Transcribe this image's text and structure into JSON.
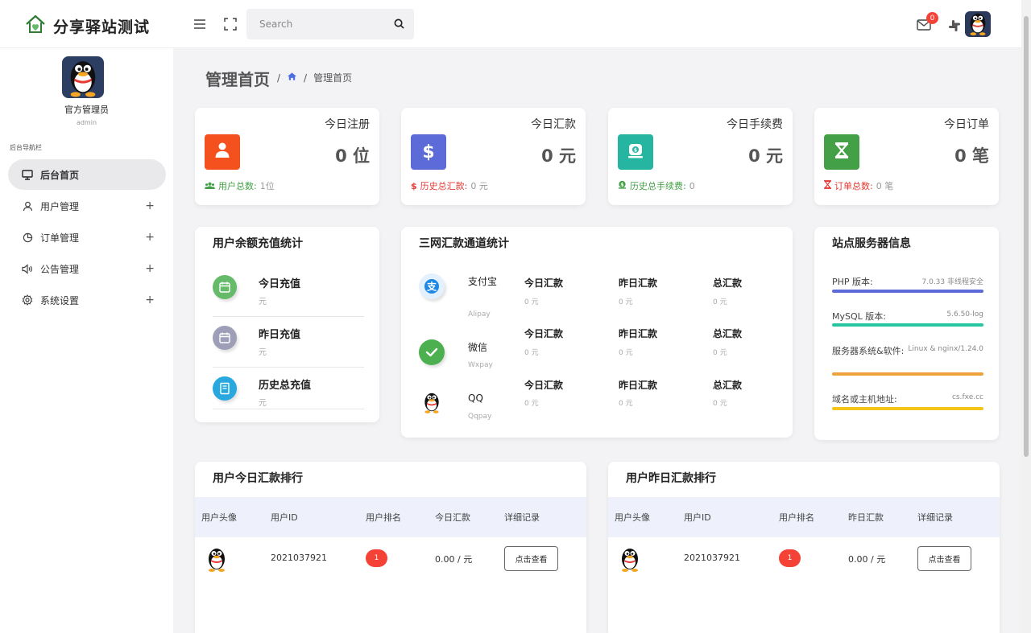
{
  "brand": {
    "name": "分享驿站测试"
  },
  "header": {
    "search_placeholder": "Search",
    "mail_badge": "0"
  },
  "sidebar": {
    "user_name": "官方管理员",
    "user_role": "admin",
    "section_title": "后台导航栏",
    "items": [
      {
        "label": "后台首页",
        "icon": "monitor-icon",
        "active": true
      },
      {
        "label": "用户管理",
        "icon": "user-icon",
        "expand": "+"
      },
      {
        "label": "订单管理",
        "icon": "pie-chart-icon",
        "expand": "+"
      },
      {
        "label": "公告管理",
        "icon": "speaker-icon",
        "expand": "+"
      },
      {
        "label": "系统设置",
        "icon": "gear-icon",
        "expand": "+"
      }
    ]
  },
  "page": {
    "title": "管理首页",
    "breadcrumb_sep": "/",
    "breadcrumb_current": "管理首页"
  },
  "stats": [
    {
      "title": "今日注册",
      "value": "0 位",
      "icon_color": "#f4511e",
      "foot_label": "用户总数:",
      "foot_value": "1位",
      "foot_color": "#43a047",
      "icon": "user-icon"
    },
    {
      "title": "今日汇款",
      "value": "0 元",
      "icon_color": "#5c6bd8",
      "foot_label": "历史总汇款:",
      "foot_value": "0 元",
      "foot_color": "#e53935",
      "icon": "dollar-icon"
    },
    {
      "title": "今日手续费",
      "value": "0 元",
      "icon_color": "#26b5a0",
      "foot_label": "历史总手续费:",
      "foot_value": "0",
      "foot_color": "#43a047",
      "icon": "money-bag-icon"
    },
    {
      "title": "今日订单",
      "value": "0 笔",
      "icon_color": "#43a047",
      "foot_label": "订单总数:",
      "foot_value": "0 笔",
      "foot_color": "#e53935",
      "icon": "hourglass-icon"
    }
  ],
  "recharge": {
    "title": "用户余额充值统计",
    "rows": [
      {
        "label": "今日充值",
        "value": "元",
        "color": "#66bb6a",
        "icon": "calendar-icon"
      },
      {
        "label": "昨日充值",
        "value": "元",
        "color": "#9e9eb8",
        "icon": "calendar-icon"
      },
      {
        "label": "历史总充值",
        "value": "元",
        "color": "#29a8e0",
        "icon": "book-icon"
      }
    ]
  },
  "channels": {
    "title": "三网汇款通道统计",
    "columns": [
      "今日汇款",
      "昨日汇款",
      "总汇款"
    ],
    "rows": [
      {
        "name": "支付宝",
        "sub": "Alipay",
        "icon": "alipay-icon",
        "values": [
          "0 元",
          "0 元",
          "0 元"
        ]
      },
      {
        "name": "微信",
        "sub": "Wxpay",
        "icon": "wechat-icon",
        "values": [
          "0 元",
          "0 元",
          "0 元"
        ]
      },
      {
        "name": "QQ",
        "sub": "Qqpay",
        "icon": "qq-icon",
        "values": [
          "0 元",
          "0 元",
          "0 元"
        ]
      }
    ]
  },
  "server": {
    "title": "站点服务器信息",
    "rows": [
      {
        "label": "PHP 版本:",
        "value": "7.0.33 非线程安全",
        "color": "#5c6bd8"
      },
      {
        "label": "MySQL 版本:",
        "value": "5.6.50-log",
        "color": "#26c6a0"
      },
      {
        "label": "服务器系统&软件:",
        "value": "Linux & nginx/1.24.0",
        "color": "#f0a23a"
      },
      {
        "label": "域名或主机地址:",
        "value": "cs.fxe.cc",
        "color": "#f5c518"
      }
    ]
  },
  "rank_today": {
    "title": "用户今日汇款排行",
    "headers": [
      "用户头像",
      "用户ID",
      "用户排名",
      "今日汇款",
      "详细记录"
    ],
    "rows": [
      {
        "user_id": "2021037921",
        "rank": "1",
        "amount": "0.00 / 元",
        "action": "点击查看"
      }
    ]
  },
  "rank_yesterday": {
    "title": "用户昨日汇款排行",
    "headers": [
      "用户头像",
      "用户ID",
      "用户排名",
      "昨日汇款",
      "详细记录"
    ],
    "rows": [
      {
        "user_id": "2021037921",
        "rank": "1",
        "amount": "0.00 / 元",
        "action": "点击查看"
      }
    ]
  }
}
